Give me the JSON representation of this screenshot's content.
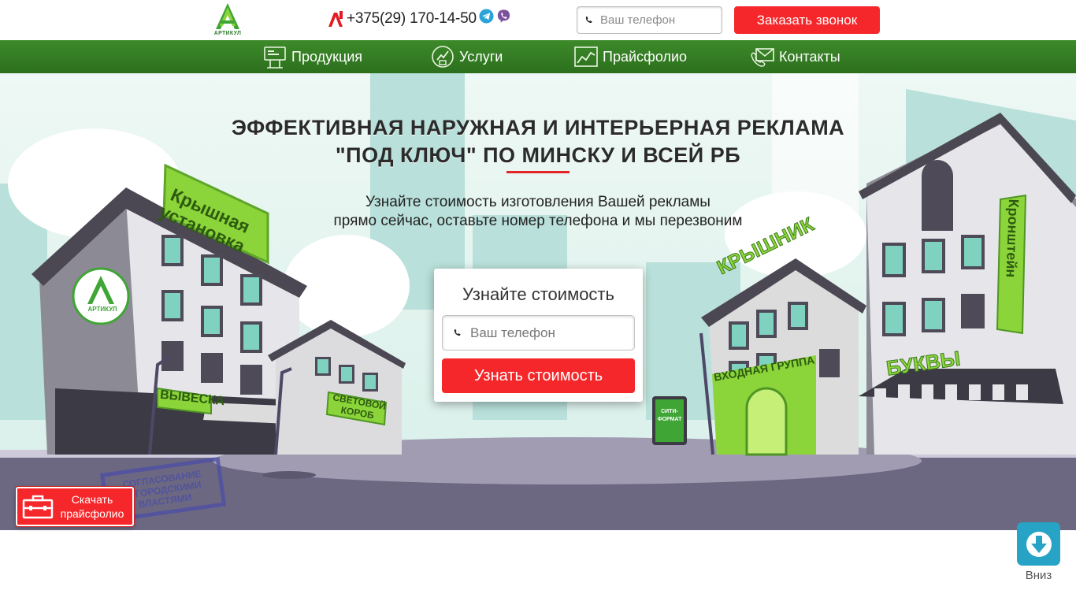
{
  "header": {
    "logo_text": "АРТИКУЛ",
    "phone": "+375(29) 170-14-50",
    "phone_placeholder": "Ваш телефон",
    "callback_button": "Заказать звонок"
  },
  "nav": {
    "items": [
      {
        "label": "Продукция",
        "icon": "billboard-icon"
      },
      {
        "label": "Услуги",
        "icon": "services-icon"
      },
      {
        "label": "Прайсфолио",
        "icon": "chart-icon"
      },
      {
        "label": "Контакты",
        "icon": "contacts-icon"
      }
    ]
  },
  "hero": {
    "title_line1": "ЭФФЕКТИВНАЯ НАРУЖНАЯ И ИНТЕРЬЕРНАЯ РЕКЛАМА",
    "title_line2": "\"ПОД КЛЮЧ\" ПО МИНСКУ И ВСЕЙ РБ",
    "subtitle_line1": "Узнайте стоимость изготовления Вашей рекламы",
    "subtitle_line2": "прямо сейчас, оставьте номер телефона и мы перезвоним"
  },
  "scene_signs": {
    "roof": "Крышная установка",
    "roof_line1": "Крышная",
    "roof_line2": "установка",
    "logo_badge": "АРТИКУЛ",
    "vyveska": "ВЫВЕСКА",
    "lightbox_line1": "СВЕТОВОЙ",
    "lightbox_line2": "КОРОБ",
    "city_line1": "СИТИ-",
    "city_line2": "ФОРМАТ",
    "kryshnik": "КРЫШНИК",
    "entrance": "ВХОДНАЯ ГРУППА",
    "letters": "БУКВЫ",
    "bracket": "Кронштейн",
    "stamp_line1": "СОГЛАСОВАНИЕ",
    "stamp_line2": "С ГОРОДСКИМИ",
    "stamp_line3": "ВЛАСТЯМИ"
  },
  "form": {
    "title": "Узнайте стоимость",
    "placeholder": "Ваш телефон",
    "button": "Узнать стоимость"
  },
  "floating": {
    "pricefolio_line1": "Скачать",
    "pricefolio_line2": "прайсфолио",
    "down_label": "Вниз"
  },
  "colors": {
    "accent_red": "#f5272a",
    "nav_green": "#358024",
    "sign_green": "#8bd43a",
    "down_blue": "#27a3c5"
  }
}
